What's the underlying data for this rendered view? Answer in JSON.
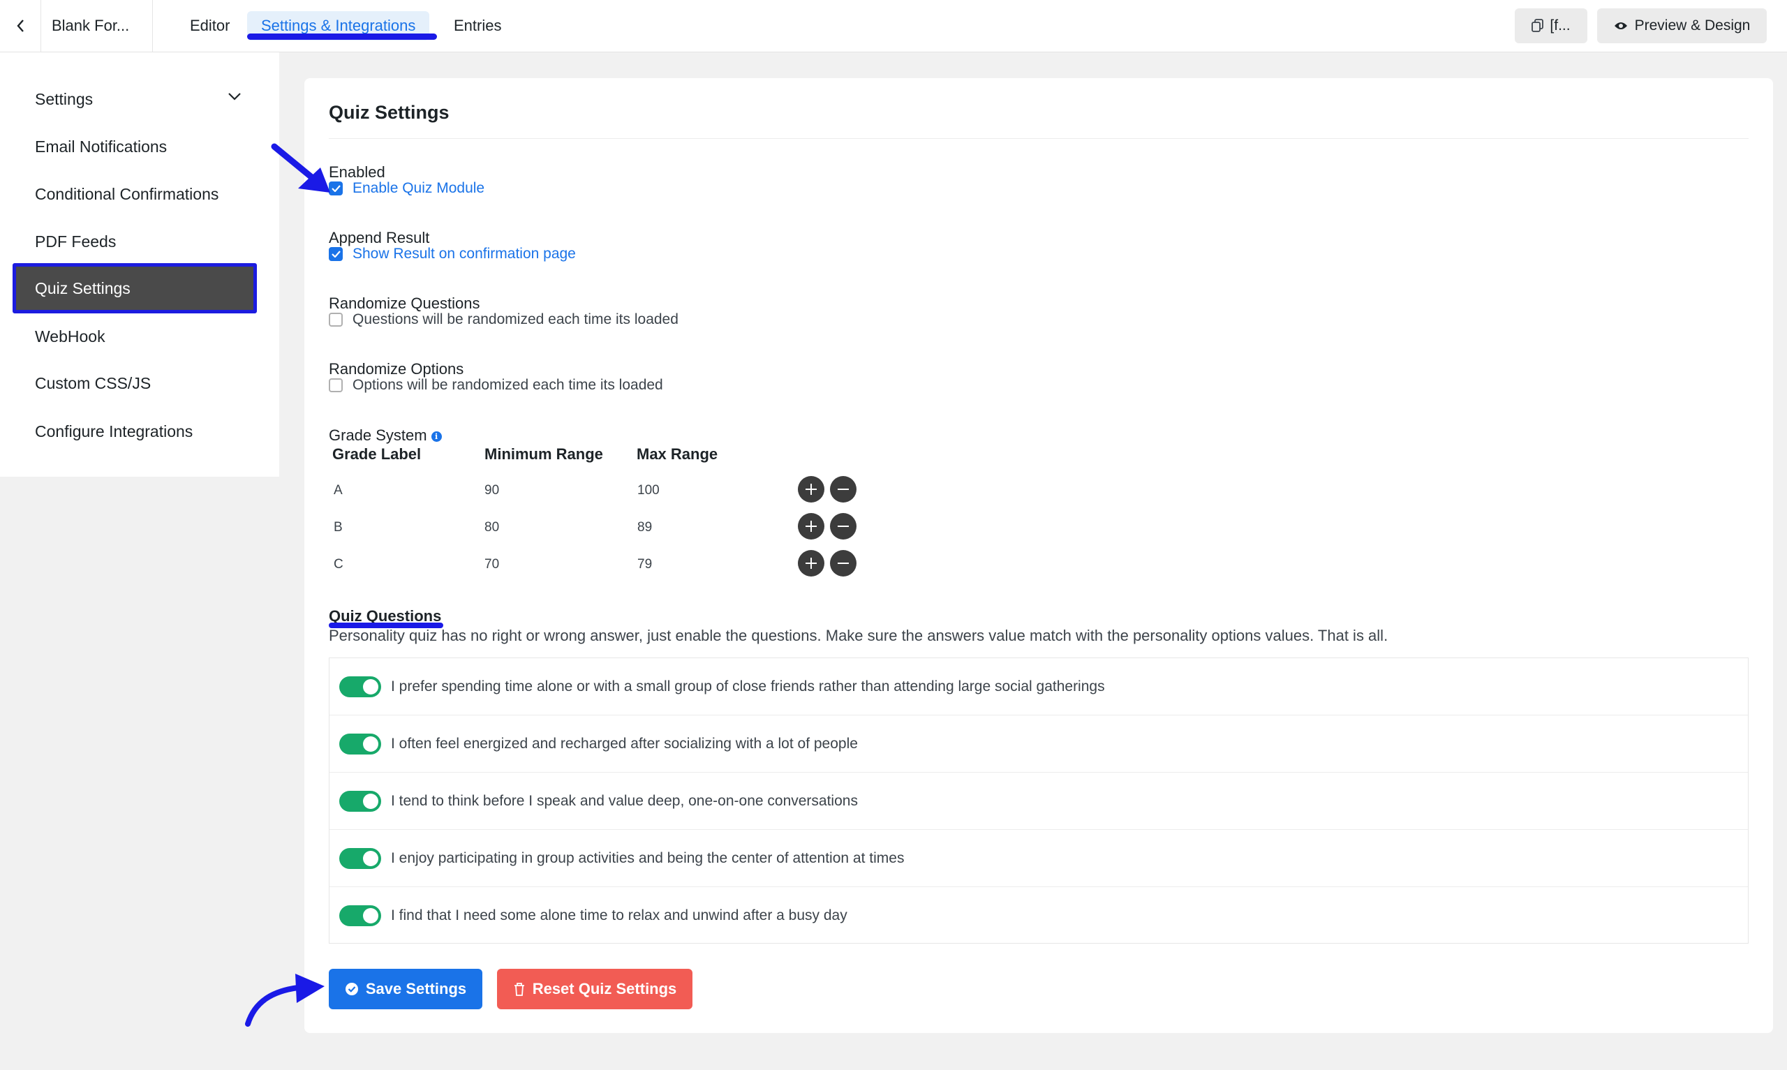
{
  "topbar": {
    "form_title": "Blank For...",
    "tabs": [
      {
        "label": "Editor"
      },
      {
        "label": "Settings & Integrations"
      },
      {
        "label": "Entries"
      }
    ],
    "shortcode_label": "[f...",
    "preview_label": "Preview & Design"
  },
  "sidebar": {
    "items": [
      {
        "label": "Settings"
      },
      {
        "label": "Email Notifications"
      },
      {
        "label": "Conditional Confirmations"
      },
      {
        "label": "PDF Feeds"
      },
      {
        "label": "Quiz Settings"
      },
      {
        "label": "WebHook"
      },
      {
        "label": "Custom CSS/JS"
      },
      {
        "label": "Configure Integrations"
      }
    ]
  },
  "main": {
    "title": "Quiz Settings",
    "enabled": {
      "label": "Enabled",
      "option": "Enable Quiz Module",
      "checked": true
    },
    "append_result": {
      "label": "Append Result",
      "option": "Show Result on confirmation page",
      "checked": true
    },
    "randomize_questions": {
      "label": "Randomize Questions",
      "option": "Questions will be randomized each time its loaded",
      "checked": false
    },
    "randomize_options": {
      "label": "Randomize Options",
      "option": "Options will be randomized each time its loaded",
      "checked": false
    },
    "grade_system": {
      "label": "Grade System",
      "headers": {
        "grade": "Grade Label",
        "min": "Minimum Range",
        "max": "Max Range"
      },
      "rows": [
        {
          "grade": "A",
          "min": "90",
          "max": "100"
        },
        {
          "grade": "B",
          "min": "80",
          "max": "89"
        },
        {
          "grade": "C",
          "min": "70",
          "max": "79"
        }
      ]
    },
    "quiz_questions": {
      "title": "Quiz Questions",
      "description": "Personality quiz has no right or wrong answer, just enable the questions. Make sure the answers value match with the personality options values. That is all.",
      "items": [
        {
          "text": "I prefer spending time alone or with a small group of close friends rather than attending large social gatherings",
          "enabled": true
        },
        {
          "text": "I often feel energized and recharged after socializing with a lot of people",
          "enabled": true
        },
        {
          "text": "I tend to think before I speak and value deep, one-on-one conversations",
          "enabled": true
        },
        {
          "text": "I enjoy participating in group activities and being the center of attention at times",
          "enabled": true
        },
        {
          "text": "I find that I need some alone time to relax and unwind after a busy day",
          "enabled": true
        }
      ]
    },
    "save_label": "Save Settings",
    "reset_label": "Reset Quiz Settings"
  },
  "colors": {
    "accent": "#1a73e8",
    "annotation": "#1a1ae6",
    "toggle_on": "#17a96a",
    "danger": "#f25c54"
  }
}
